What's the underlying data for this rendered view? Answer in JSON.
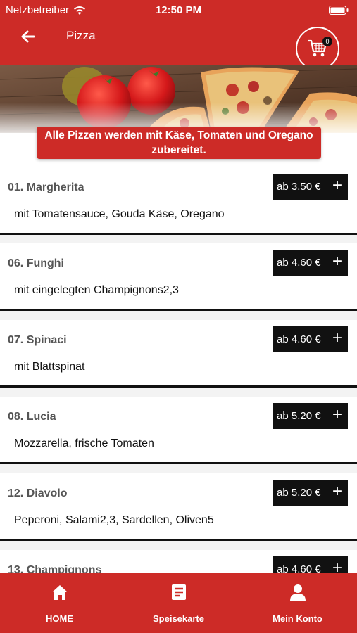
{
  "status_bar": {
    "carrier": "Netzbetreiber",
    "time": "12:50 PM"
  },
  "header": {
    "title": "Pizza",
    "cart_count": "0"
  },
  "hero": {
    "banner_text": "Alle Pizzen werden mit Käse, Tomaten und Oregano zubereitet."
  },
  "menu": {
    "items": [
      {
        "name": "01. Margherita",
        "description": "mit Tomatensauce, Gouda Käse, Oregano",
        "price": "ab 3.50 €"
      },
      {
        "name": "06. Funghi",
        "description": "mit eingelegten Champignons2,3",
        "price": "ab 4.60 €"
      },
      {
        "name": "07. Spinaci",
        "description": "mit Blattspinat",
        "price": "ab 4.60 €"
      },
      {
        "name": "08. Lucia",
        "description": "Mozzarella, frische Tomaten",
        "price": "ab 5.20 €"
      },
      {
        "name": "12. Diavolo",
        "description": "Peperoni, Salami2,3, Sardellen, Oliven5",
        "price": "ab 5.20 €"
      },
      {
        "name": "13. Champignons",
        "description": "",
        "price": "ab 4.60 €"
      }
    ]
  },
  "bottom_nav": {
    "items": [
      {
        "label": "HOME",
        "icon": "home-icon"
      },
      {
        "label": "Speisekarte",
        "icon": "menu-card-icon"
      },
      {
        "label": "Mein Konto",
        "icon": "user-icon"
      }
    ]
  },
  "colors": {
    "brand_red": "#cd2b27",
    "price_button": "#111111"
  }
}
